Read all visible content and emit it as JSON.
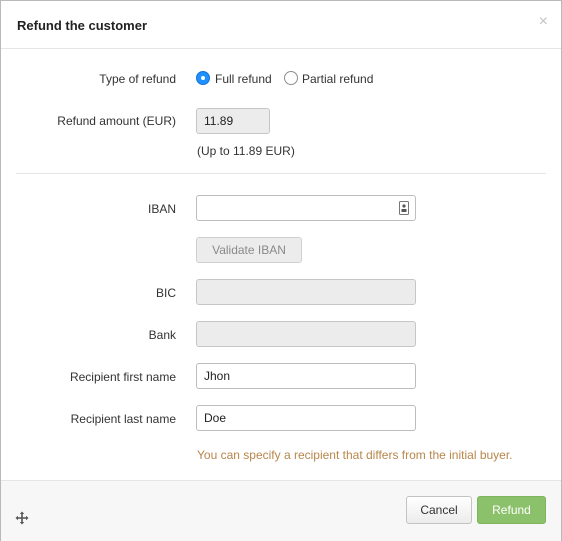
{
  "dialog": {
    "title": "Refund the customer",
    "close_glyph": "×"
  },
  "refund_type": {
    "label": "Type of refund",
    "options": [
      {
        "label": "Full refund",
        "checked": true
      },
      {
        "label": "Partial refund",
        "checked": false
      }
    ]
  },
  "amount": {
    "label": "Refund amount (EUR)",
    "value": "11.89",
    "hint": "(Up to 11.89 EUR)"
  },
  "iban": {
    "label": "IBAN",
    "value": "",
    "icon": "contact-card-icon"
  },
  "validate_button": "Validate IBAN",
  "bic": {
    "label": "BIC",
    "value": ""
  },
  "bank": {
    "label": "Bank",
    "value": ""
  },
  "first_name": {
    "label": "Recipient first name",
    "value": "Jhon"
  },
  "last_name": {
    "label": "Recipient last name",
    "value": "Doe"
  },
  "recipient_note": "You can specify a recipient that differs from the initial buyer.",
  "footer": {
    "cancel_label": "Cancel",
    "refund_label": "Refund",
    "move_icon": "move-icon"
  },
  "colors": {
    "accent": "#1e90ff",
    "refund_button": "#8cc16b",
    "note_text": "#b8864b"
  }
}
